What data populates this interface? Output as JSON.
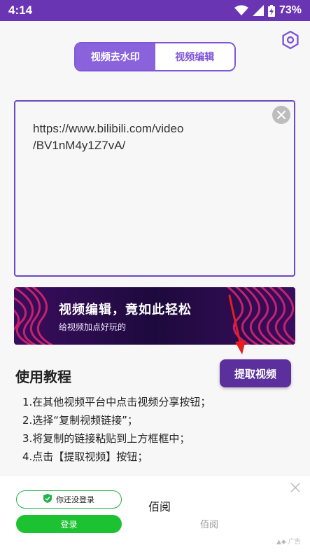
{
  "status_bar": {
    "time": "4:14",
    "battery": "73%"
  },
  "tabs": [
    {
      "label": "视频去水印",
      "active": true
    },
    {
      "label": "视频编辑",
      "active": false
    }
  ],
  "url_input": {
    "value": "https://www.bilibili.com/video\n/BV1nM4y1Z7vA/"
  },
  "banner": {
    "title": "视频编辑，竟如此轻松",
    "subtitle": "给视频加点好玩的"
  },
  "extract_button": {
    "label": "提取视频"
  },
  "tutorial": {
    "title": "使用教程",
    "steps": [
      "1.在其他视频平台中点击视频分享按钮；",
      "2.选择“复制视频链接”；",
      "3.将复制的链接粘贴到上方框框中；",
      "4.点击【提取视频】按钮；"
    ]
  },
  "ad": {
    "login_hint": "你还没登录",
    "login_button": "登录",
    "app_name": "佰阅",
    "app_sub": "佰阅",
    "ad_tag": "广告"
  },
  "icons": {
    "settings": "hexagon-settings-icon",
    "clear": "clear-x-icon",
    "wifi": "wifi-icon",
    "signal": "signal-icon",
    "battery": "battery-charging-icon"
  },
  "colors": {
    "accent": "#7e57d6",
    "status_bar": "#6a35b3",
    "button": "#5b2f9c",
    "ad_green": "#1cc232"
  }
}
